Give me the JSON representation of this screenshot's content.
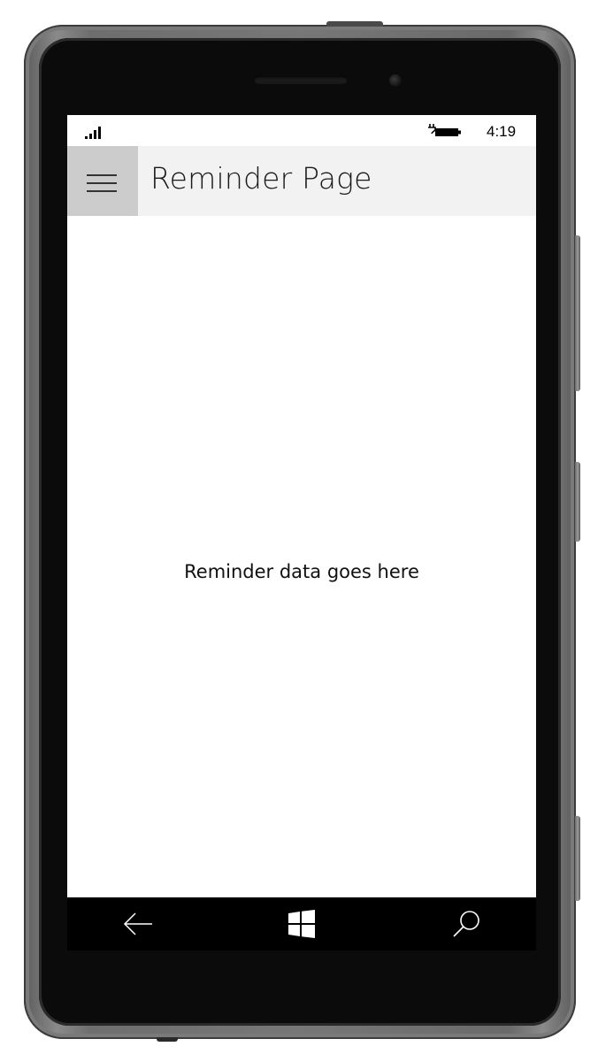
{
  "status_bar": {
    "time": "4:19",
    "signal_icon": "signal-bars-icon",
    "battery_icon": "battery-charging-icon"
  },
  "header": {
    "menu_icon": "hamburger-menu-icon",
    "title": "Reminder Page"
  },
  "content": {
    "message": "Reminder data goes here"
  },
  "nav_bar": {
    "back_icon": "back-arrow-icon",
    "home_icon": "windows-logo-icon",
    "search_icon": "search-icon"
  },
  "colors": {
    "header_bg": "#f2f2f2",
    "menu_button_bg": "#cccccc",
    "nav_bar_bg": "#000000",
    "screen_bg": "#ffffff"
  }
}
